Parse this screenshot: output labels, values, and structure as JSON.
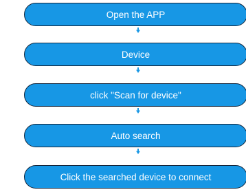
{
  "flowchart": {
    "accent_color": "#1797e5",
    "border_color": "#11243a",
    "steps": [
      {
        "label": "Open the APP"
      },
      {
        "label": "Device"
      },
      {
        "label": "click \"Scan for device\""
      },
      {
        "label": "Auto search"
      },
      {
        "label": "Click the searched device to connect"
      }
    ]
  }
}
